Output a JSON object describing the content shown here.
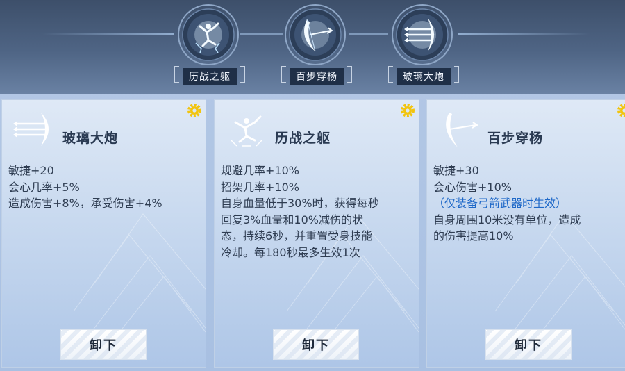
{
  "tabs": [
    {
      "label": "历战之躯",
      "icon": "acrobat-figure-icon"
    },
    {
      "label": "百步穿杨",
      "icon": "crescent-bow-icon"
    },
    {
      "label": "玻璃大炮",
      "icon": "triple-arrow-icon"
    }
  ],
  "cards": [
    {
      "name": "玻璃大炮",
      "icon": "triple-arrow-icon",
      "lines": [
        "敏捷+20",
        "会心几率+5%",
        "造成伤害+8%，承受伤害+4%"
      ],
      "button": "卸下"
    },
    {
      "name": "历战之躯",
      "icon": "acrobat-figure-icon",
      "lines": [
        "规避几率+10%",
        "招架几率+10%",
        "自身血量低于30%时，获得每秒",
        "回复3%血量和10%减伤的状",
        "态，持续6秒，并重置受身技能",
        "冷却。每180秒最多生效1次"
      ],
      "button": "卸下"
    },
    {
      "name": "百步穿杨",
      "icon": "crescent-bow-icon",
      "lines": [
        "敏捷+30",
        "会心伤害+10%"
      ],
      "note": "（仅装备弓箭武器时生效）",
      "lines_after": [
        "自身周围10米没有单位，造成",
        "的伤害提高10%"
      ],
      "button": "卸下"
    }
  ],
  "colors": {
    "header": "#4f6585",
    "card_text": "#2f3d52",
    "note": "#1e68c8",
    "gear": "#f2c40e"
  }
}
